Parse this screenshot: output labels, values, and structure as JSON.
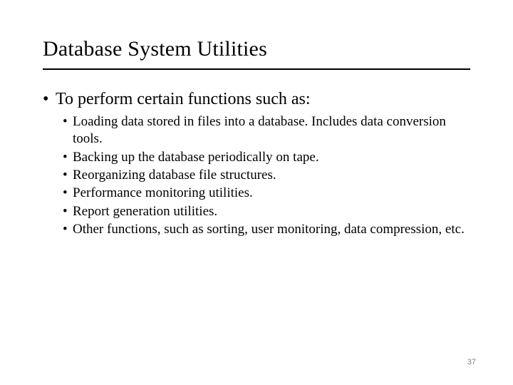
{
  "title": "Database System Utilities",
  "lvl1": "To perform certain functions such as:",
  "lvl2": [
    "Loading data stored in files into a database. Includes data conversion tools.",
    "Backing up the database periodically on tape.",
    "Reorganizing database file structures.",
    "Performance monitoring utilities.",
    "Report generation utilities.",
    "Other functions, such as sorting, user monitoring, data compression, etc."
  ],
  "page": "37"
}
